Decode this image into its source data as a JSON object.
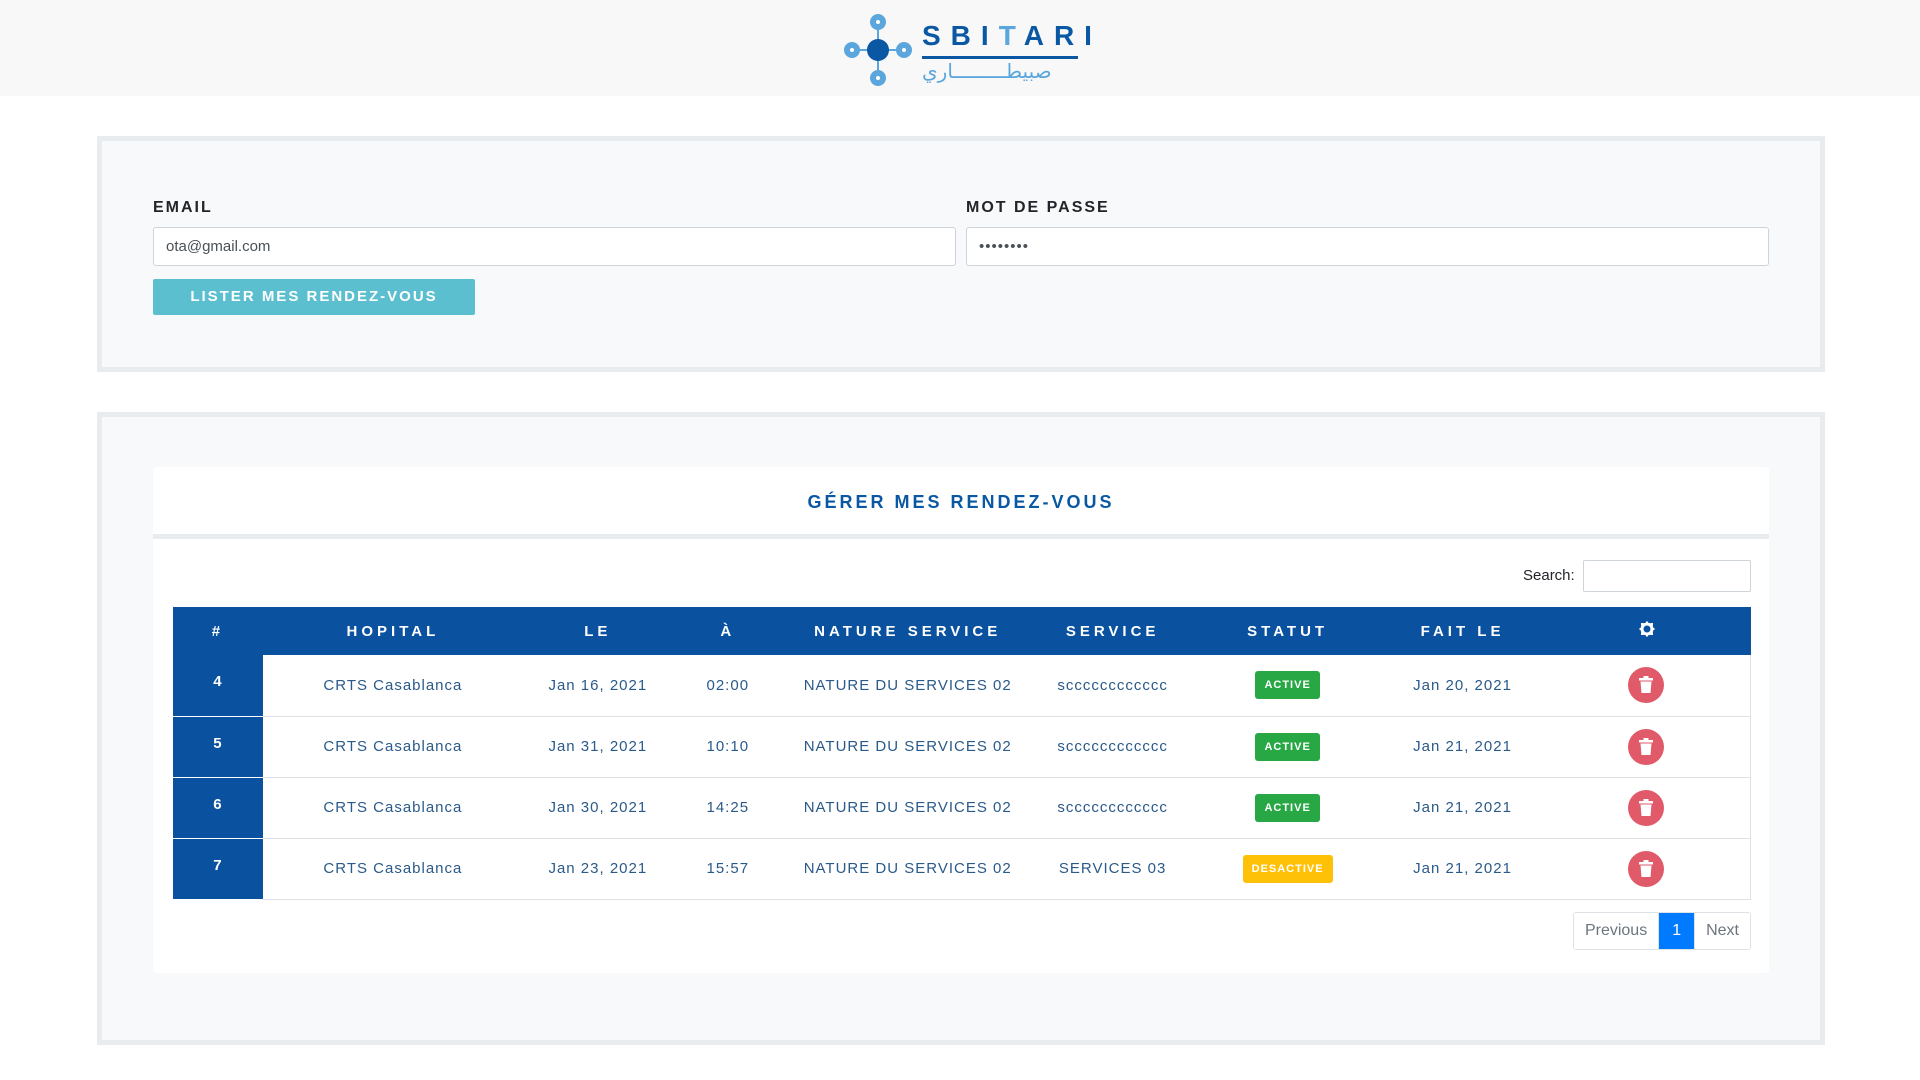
{
  "brand": {
    "name_prefix": "SBI",
    "name_accent": "T",
    "name_suffix": "ARI",
    "name_arabic": "صبيطـــــــــاري",
    "logo_icon": "molecule-logo-icon"
  },
  "login": {
    "email_label": "EMAIL",
    "email_value": "ota@gmail.com",
    "password_label": "MOT DE PASSE",
    "password_value": "••••••••",
    "submit_label": "LISTER MES RENDEZ-VOUS"
  },
  "appointments": {
    "title": "GÉRER MES RENDEZ-VOUS",
    "search_label": "Search:",
    "search_value": "",
    "columns": [
      "#",
      "HOPITAL",
      "LE",
      "À",
      "NATURE SERVICE",
      "SERVICE",
      "STATUT",
      "FAIT LE"
    ],
    "actions_icon": "gear-icon",
    "delete_icon": "trash-icon",
    "rows": [
      {
        "id": "4",
        "hopital": "CRTS Casablanca",
        "le": "Jan 16, 2021",
        "a": "02:00",
        "nature": "NATURE DU SERVICES 02",
        "service": "scccccccccccc",
        "statut": "ACTIVE",
        "fait_le": "Jan 20, 2021"
      },
      {
        "id": "5",
        "hopital": "CRTS Casablanca",
        "le": "Jan 31, 2021",
        "a": "10:10",
        "nature": "NATURE DU SERVICES 02",
        "service": "scccccccccccc",
        "statut": "ACTIVE",
        "fait_le": "Jan 21, 2021"
      },
      {
        "id": "6",
        "hopital": "CRTS Casablanca",
        "le": "Jan 30, 2021",
        "a": "14:25",
        "nature": "NATURE DU SERVICES 02",
        "service": "scccccccccccc",
        "statut": "ACTIVE",
        "fait_le": "Jan 21, 2021"
      },
      {
        "id": "7",
        "hopital": "CRTS Casablanca",
        "le": "Jan 23, 2021",
        "a": "15:57",
        "nature": "NATURE DU SERVICES 02",
        "service": "SERVICES 03",
        "statut": "DESACTIVE",
        "fait_le": "Jan 21, 2021"
      }
    ],
    "pagination": {
      "previous": "Previous",
      "current": "1",
      "next": "Next"
    }
  },
  "colors": {
    "primary": "#0a52a0",
    "info_button": "#5bbfd0",
    "active_badge": "#28a745",
    "inactive_badge": "#ffc107",
    "delete_button": "#e05a6a",
    "page_active": "#007bff"
  }
}
